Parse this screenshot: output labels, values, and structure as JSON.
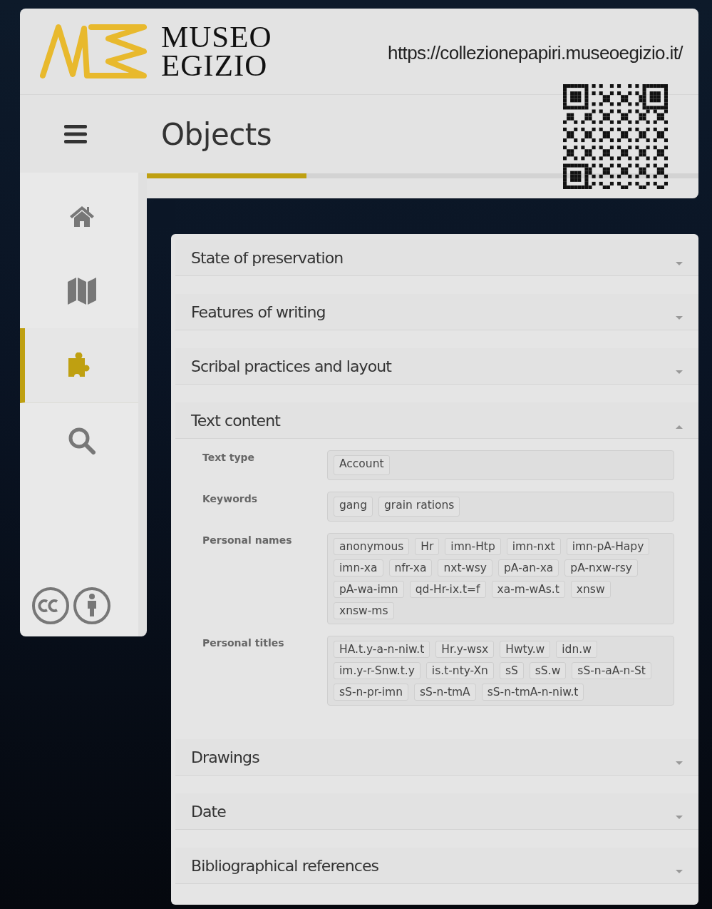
{
  "header": {
    "logo_lines": [
      "MUSEO",
      "EGIZIO"
    ],
    "url": "https://collezionepapiri.museoegizio.it/"
  },
  "nav": {
    "title": "Objects"
  },
  "sidebar": {
    "items": [
      {
        "selected": false
      },
      {
        "selected": false
      },
      {
        "selected": true
      },
      {
        "selected": false
      }
    ]
  },
  "sections": [
    {
      "title": "State of preservation",
      "expanded": false
    },
    {
      "title": "Features of writing",
      "expanded": false
    },
    {
      "title": "Scribal practices and layout",
      "expanded": false
    },
    {
      "title": "Text content",
      "expanded": true,
      "fields": [
        {
          "label": "Text type",
          "tags": [
            "Account"
          ]
        },
        {
          "label": "Keywords",
          "tags": [
            "gang",
            "grain rations"
          ]
        },
        {
          "label": "Personal names",
          "tags": [
            "anonymous",
            "Hr",
            "imn-Htp",
            "imn-nxt",
            "imn-pA-Hapy",
            "imn-xa",
            "nfr-xa",
            "nxt-wsy",
            "pA-an-xa",
            "pA-nxw-rsy",
            "pA-wa-imn",
            "qd-Hr-ix.t=f",
            "xa-m-wAs.t",
            "xnsw",
            "xnsw-ms"
          ]
        },
        {
          "label": "Personal titles",
          "tags": [
            "HA.t.y-a-n-niw.t",
            "Hr.y-wsx",
            "Hwty.w",
            "idn.w",
            "im.y-r-Snw.t.y",
            "is.t-nty-Xn",
            "sS",
            "sS.w",
            "sS-n-aA-n-St",
            "sS-n-pr-imn",
            "sS-n-tmA",
            "sS-n-tmA-n-niw.t"
          ]
        }
      ]
    },
    {
      "title": "Drawings",
      "expanded": false
    },
    {
      "title": "Date",
      "expanded": false
    },
    {
      "title": "Bibliographical references",
      "expanded": false
    }
  ]
}
